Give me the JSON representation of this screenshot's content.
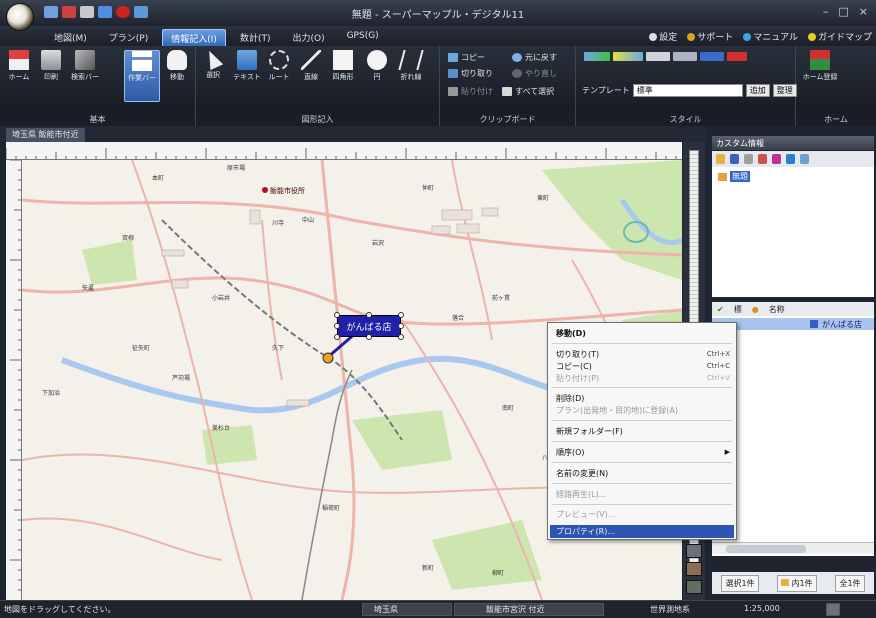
{
  "window": {
    "title": "無題 - スーパーマップル・デジタル11",
    "controls": [
      "–",
      "□",
      "×"
    ]
  },
  "menu": {
    "tabs": [
      {
        "label": "地図(M)",
        "active": false
      },
      {
        "label": "プラン(P)",
        "active": false
      },
      {
        "label": "情報記入(I)",
        "active": true
      },
      {
        "label": "数計(T)",
        "active": false
      },
      {
        "label": "出力(O)",
        "active": false
      },
      {
        "label": "GPS(G)",
        "active": false
      }
    ],
    "links": [
      "設定",
      "サポート",
      "マニュアル",
      "ガイドマップ"
    ]
  },
  "ribbon": {
    "basic": {
      "label": "基本",
      "buttons": [
        "ホーム",
        "印刷",
        "検索バー",
        "作業バー",
        "移動"
      ]
    },
    "figures": {
      "label": "図形記入",
      "buttons": [
        "選択",
        "テキスト",
        "ルート",
        "直線",
        "四角形",
        "円",
        "折れ線"
      ]
    },
    "clipboard": {
      "label": "クリップボード",
      "items": [
        "コピー",
        "元に戻す",
        "切り取り",
        "やり直し",
        "貼り付け",
        "すべて選択"
      ]
    },
    "style": {
      "label": "スタイル",
      "template_label": "テンプレート",
      "template_value": "標準",
      "add_label": "追加",
      "organize_label": "整理"
    },
    "home": {
      "label": "ホーム",
      "button": "ホーム登録"
    }
  },
  "document": {
    "tab": "埼玉県 飯能市付近"
  },
  "panel": {
    "title": "カスタム情報",
    "tree_root": "無題",
    "columns": [
      "標",
      "名称"
    ],
    "row_name": "がんばる店",
    "footer": {
      "selected": "選択1件",
      "inside": "内1件",
      "total": "全1件"
    }
  },
  "map": {
    "selected_label": "がんばる店",
    "poi_city_hall": "飯能市役所",
    "labels": [
      "本町",
      "原市場",
      "仲町",
      "東町",
      "双柳",
      "川寺",
      "中山",
      "岩沢",
      "矢颪",
      "小岩井",
      "征矢町",
      "芦苅場",
      "久下",
      "落合",
      "前ヶ貫",
      "下加治",
      "美杉台",
      "南町",
      "稲荷町",
      "新町",
      "柳町",
      "八幡町"
    ]
  },
  "context_menu": {
    "items": [
      {
        "label": "移動(D)",
        "shortcut": "",
        "disabled": false,
        "bold": true
      },
      {
        "label": "切り取り(T)",
        "shortcut": "Ctrl+X",
        "disabled": false
      },
      {
        "label": "コピー(C)",
        "shortcut": "Ctrl+C",
        "disabled": false
      },
      {
        "label": "貼り付け(P)",
        "shortcut": "Ctrl+V",
        "disabled": true
      },
      {
        "label": "削除(D)",
        "shortcut": "",
        "disabled": false
      },
      {
        "label": "プラン(出発地・目的地)に登録(A)",
        "shortcut": "",
        "disabled": true
      },
      {
        "label": "新規フォルダー(F)",
        "shortcut": "",
        "disabled": false
      },
      {
        "label": "順序(O)",
        "shortcut": "",
        "disabled": false,
        "submenu": true
      },
      {
        "label": "名前の変更(N)",
        "shortcut": "",
        "disabled": false
      },
      {
        "label": "経路再生(L)...",
        "shortcut": "",
        "disabled": true
      },
      {
        "label": "プレビュー(V)...",
        "shortcut": "",
        "disabled": true
      },
      {
        "label": "プロパティ(R)...",
        "shortcut": "",
        "disabled": false,
        "highlighted": true
      }
    ]
  },
  "status": {
    "hint": "地図をドラッグしてください。",
    "pref": "埼玉県",
    "area": "飯能市宮沢 付近",
    "datum": "世界測地系",
    "scale": "1:25,000"
  },
  "colors": {
    "accent": "#2f55b4",
    "selected_label_bg": "#2020a8",
    "road": "#f0a8a0",
    "river": "#8fb8e8",
    "green": "#bfe0a0"
  }
}
